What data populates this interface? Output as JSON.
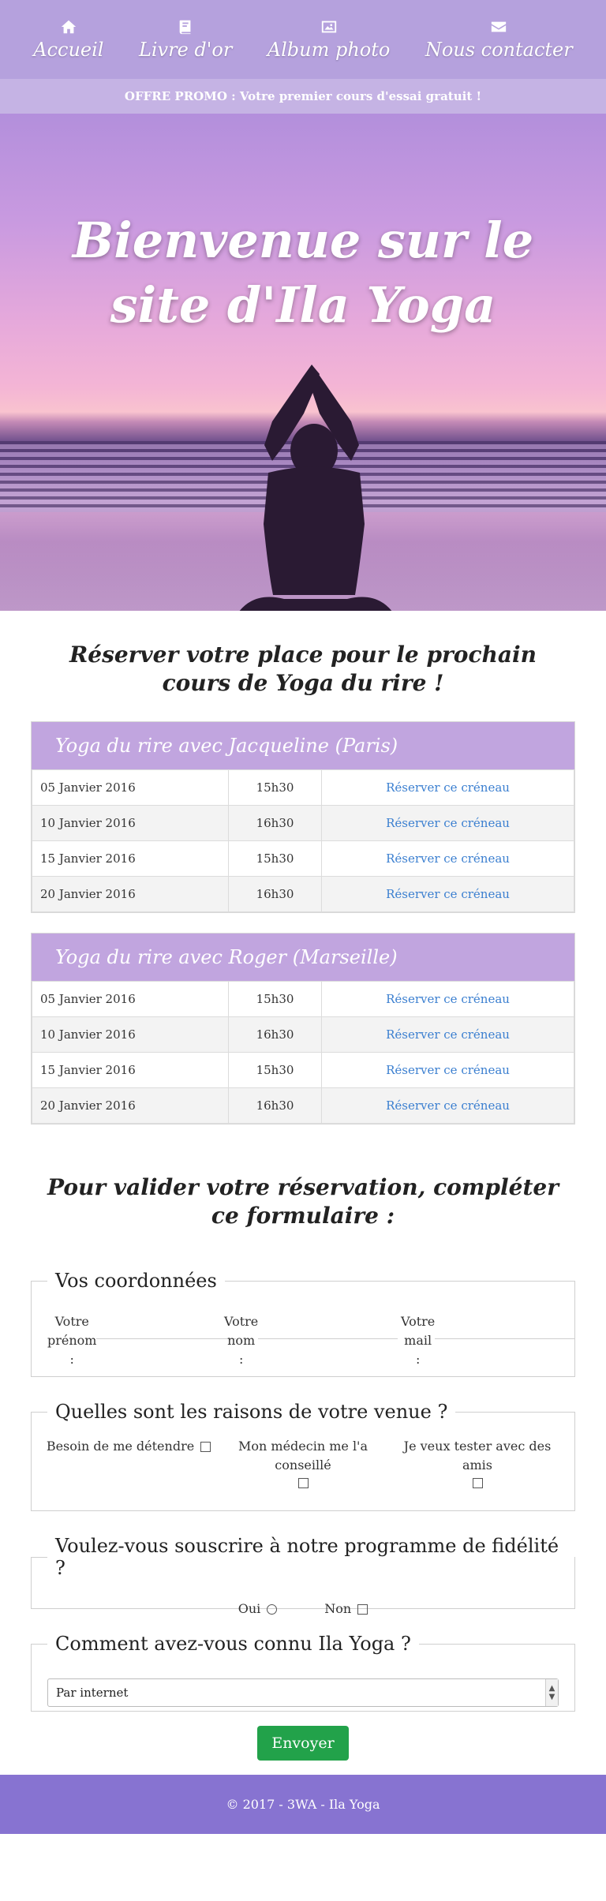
{
  "nav": [
    {
      "label": "Accueil",
      "icon": "home-icon"
    },
    {
      "label": "Livre d'or",
      "icon": "book-icon"
    },
    {
      "label": "Album photo",
      "icon": "image-icon"
    },
    {
      "label": "Nous contacter",
      "icon": "envelope-icon"
    }
  ],
  "promo": "OFFRE PROMO : Votre premier cours d'essai gratuit !",
  "hero": {
    "title": "Bienvenue sur le site d'Ila Yoga"
  },
  "booking_title": "Réserver votre place pour le prochain cours de Yoga du rire !",
  "schedules": [
    {
      "title": "Yoga du rire avec Jacqueline (Paris)",
      "rows": [
        {
          "date": "05 Janvier 2016",
          "time": "15h30",
          "action": "Réserver ce créneau"
        },
        {
          "date": "10 Janvier 2016",
          "time": "16h30",
          "action": "Réserver ce créneau"
        },
        {
          "date": "15 Janvier 2016",
          "time": "15h30",
          "action": "Réserver ce créneau"
        },
        {
          "date": "20 Janvier 2016",
          "time": "16h30",
          "action": "Réserver ce créneau"
        }
      ]
    },
    {
      "title": "Yoga du rire avec Roger (Marseille)",
      "rows": [
        {
          "date": "05 Janvier 2016",
          "time": "15h30",
          "action": "Réserver ce créneau"
        },
        {
          "date": "10 Janvier 2016",
          "time": "16h30",
          "action": "Réserver ce créneau"
        },
        {
          "date": "15 Janvier 2016",
          "time": "15h30",
          "action": "Réserver ce créneau"
        },
        {
          "date": "20 Janvier 2016",
          "time": "16h30",
          "action": "Réserver ce créneau"
        }
      ]
    }
  ],
  "form_title": "Pour valider votre réservation, compléter ce formulaire :",
  "form": {
    "coordinates": {
      "legend": "Vos coordonnées",
      "firstname_label": "Votre prénom :",
      "lastname_label": "Votre nom :",
      "mail_label": "Votre mail :"
    },
    "reasons": {
      "legend": "Quelles sont les raisons de votre venue ?",
      "options": [
        "Besoin de me détendre",
        "Mon médecin me l'a conseillé",
        "Je veux tester avec des amis"
      ]
    },
    "loyalty": {
      "legend": "Voulez-vous souscrire à notre programme de fidélité ?",
      "yes": "Oui",
      "no": "Non"
    },
    "source": {
      "legend": "Comment avez-vous connu Ila Yoga ?",
      "selected": "Par internet"
    },
    "submit": "Envoyer"
  },
  "footer": "© 2017 - 3WA - Ila Yoga",
  "colors": {
    "nav_bg": "#b5a1dd",
    "promo_bg": "#c5b3e4",
    "table_header": "#c1a5df",
    "link": "#3b7fd0",
    "submit": "#22a24a",
    "footer_bg": "#8773d1"
  }
}
